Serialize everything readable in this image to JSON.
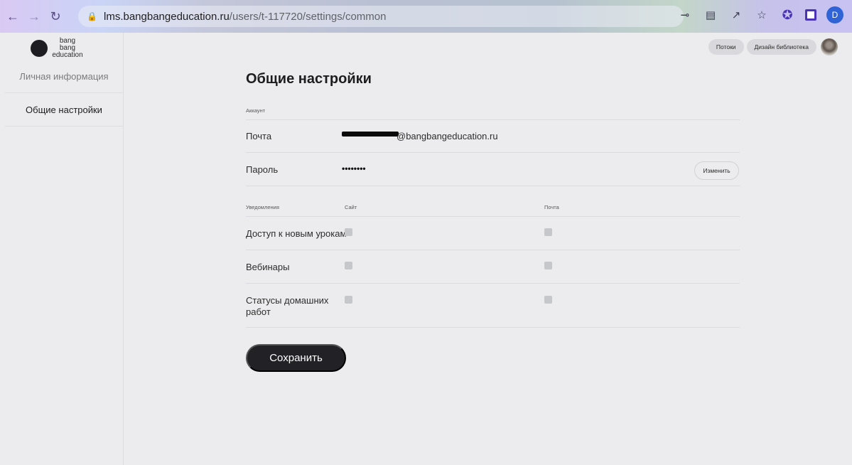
{
  "browser": {
    "url_host": "lms.bangbangeducation.ru",
    "url_path": "/users/t-117720/settings/common",
    "profile_initial": "D"
  },
  "logo": {
    "line1": "bang bang",
    "line2": "education"
  },
  "sidebar": {
    "items": [
      {
        "label": "Личная информация"
      },
      {
        "label": "Общие настройки"
      }
    ]
  },
  "header": {
    "streams_label": "Потоки",
    "library_label": "Дизайн библиотека"
  },
  "settings": {
    "title": "Общие настройки",
    "account_label": "Аккаунт",
    "email_label": "Почта",
    "email_domain": "@bangbangeducation.ru",
    "password_label": "Пароль",
    "password_value": "••••••••",
    "change_label": "Изменить",
    "notifications": {
      "label": "Уведомления",
      "col_site": "Сайт",
      "col_mail": "Почта",
      "rows": [
        {
          "label": "Доступ к новым урокам",
          "site": false,
          "mail": false
        },
        {
          "label": "Вебинары",
          "site": false,
          "mail": false
        },
        {
          "label": "Статусы домашних работ",
          "site": false,
          "mail": false
        }
      ]
    },
    "save_label": "Сохранить"
  },
  "colors": {
    "page_bg": "#ececee",
    "button_dark": "#222226",
    "checkbox": "#c6c7cb",
    "divider": "#dcdce0"
  }
}
